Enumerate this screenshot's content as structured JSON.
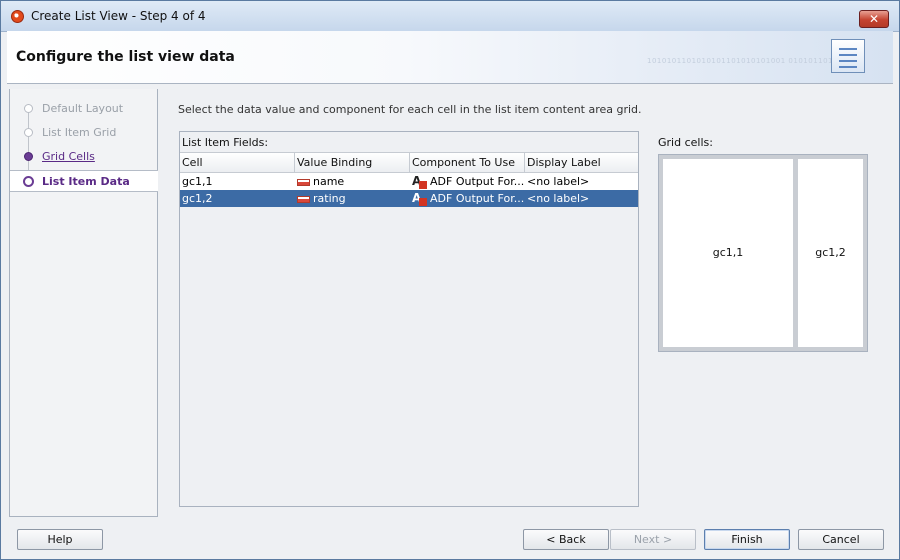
{
  "window": {
    "title": "Create List View - Step 4 of 4",
    "close_glyph": "✕"
  },
  "header": {
    "title": "Configure the list view data",
    "decor_text": "1010101101010101101010101001 0101011010101"
  },
  "steps": [
    {
      "label": "Default Layout",
      "state": "disabled"
    },
    {
      "label": "List Item Grid",
      "state": "disabled"
    },
    {
      "label": "Grid Cells",
      "state": "link"
    },
    {
      "label": "List Item Data",
      "state": "current"
    }
  ],
  "instruction": "Select the data value and component for each cell in the list item content area grid.",
  "fields": {
    "title": "List Item Fields:",
    "columns": [
      "Cell",
      "Value Binding",
      "Component To Use",
      "Display Label"
    ],
    "rows": [
      {
        "cell": "gc1,1",
        "binding": "name",
        "component": "ADF Output For...",
        "label": "<no label>",
        "selected": false
      },
      {
        "cell": "gc1,2",
        "binding": "rating",
        "component": "ADF Output For...",
        "label": "<no label>",
        "selected": true
      }
    ]
  },
  "grid": {
    "title": "Grid cells:",
    "cells": [
      "gc1,1",
      "gc1,2"
    ]
  },
  "buttons": {
    "help": "Help",
    "back": "< Back",
    "next": "Next >",
    "finish": "Finish",
    "cancel": "Cancel"
  },
  "icons": {
    "app": "oracle-jdeveloper-icon",
    "wizard": "list-wizard-icon",
    "field": "attribute-field-icon",
    "component": "adf-output-icon"
  },
  "colors": {
    "selection": "#3c6ba5",
    "link": "#5a2a86",
    "close": "#c54330"
  }
}
